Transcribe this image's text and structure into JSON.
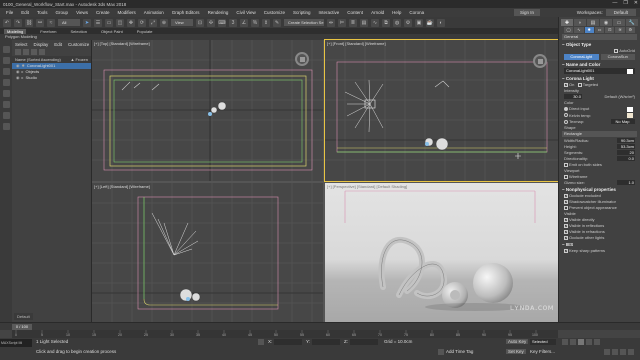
{
  "window": {
    "title": "0100_General_Workflow_Start.max - Autodesk 3ds Max 2018",
    "controls": [
      "—",
      "❐",
      "✕"
    ]
  },
  "menu": {
    "items": [
      "File",
      "Edit",
      "Tools",
      "Group",
      "Views",
      "Create",
      "Modifiers",
      "Animation",
      "Graph Editors",
      "Rendering",
      "Civil View",
      "Customize",
      "Scripting",
      "Interactive",
      "Content",
      "Arnold",
      "Help",
      "Corona"
    ],
    "sign_in": "Sign In",
    "workspaces_label": "Workspaces:",
    "workspace_value": "Default"
  },
  "toolbar": {
    "selection_filter": "All",
    "view": "View",
    "create_selection_set": "Create Selection Se"
  },
  "ribbon": {
    "tabs": [
      "Modeling",
      "Freeform",
      "Selection",
      "Object Paint",
      "Populate"
    ],
    "active_tab": "Modeling",
    "sub_label": "Polygon Modeling"
  },
  "scene_explorer": {
    "tabs": [
      "Select",
      "Display",
      "Edit",
      "Customize"
    ],
    "header": "Name (Sorted Ascending)",
    "header_right": "▲ Frozen",
    "rows": [
      {
        "name": "CoronaLight001",
        "selected": true
      },
      {
        "name": "Objects",
        "selected": false
      },
      {
        "name": "Studio",
        "selected": false
      }
    ],
    "footer": "Default"
  },
  "viewports": [
    {
      "key": "top",
      "label": "[+] [Top] [Standard] [Wireframe]"
    },
    {
      "key": "front",
      "label": "[+] [Front] [Standard] [Wireframe]"
    },
    {
      "key": "left",
      "label": "[+] [Left] [Standard] [Wireframe]"
    },
    {
      "key": "persp",
      "label": "[+] [Perspective] [Standard] [Default Shading]"
    }
  ],
  "command_panel": {
    "tabs": [
      "✚",
      "◗",
      "▤",
      "◉",
      "▭",
      "🔧"
    ],
    "category": "General",
    "object_type": {
      "title": "Object Type",
      "autogrid": "AutoGrid",
      "buttons": [
        "CoronaLight",
        "CoronaSun"
      ]
    },
    "name_and_color": {
      "title": "Name and Color",
      "name": "CoronaLight001"
    },
    "corona_light": {
      "title": "Corona Light",
      "on_label": "On",
      "targeted_label": "Targeted",
      "intensity_label": "Intensity",
      "intensity_value": "30.0",
      "intensity_unit": "Default (W/sr/m²)",
      "color_label": "Color",
      "direct_input": "Direct input",
      "kelvin_temp": "Kelvin temp:",
      "texmap": "Texmap:",
      "texmap_value": "No Map",
      "shape_label": "Shape",
      "shape_value": "Rectangle",
      "width_label": "Width/Radius:",
      "width_value": "90.3cm",
      "height_label": "Height:",
      "height_value": "53.3cm",
      "segments_label": "Segments:",
      "segments_value": "20",
      "directionality_label": "Directionality:",
      "directionality_value": "0.0",
      "emit_both": "Emit on both sides"
    },
    "viewport_section": {
      "title": "Viewport",
      "wireframe": "Wireframe",
      "gizmo_size": "Gizmo size:",
      "gizmo_value": "1.0"
    },
    "nonphysical": {
      "title": "Nonphysical properties",
      "items": [
        "Occlude excluded",
        "Shadowcatcher illuminator",
        "Prevent object appearance"
      ],
      "visible_label": "Visible",
      "visible_items": [
        "Visible directly",
        "Visible in reflections",
        "Visible in refractions",
        "Occlude other lights"
      ]
    },
    "ies": {
      "title": "IES",
      "items": [
        "Keep sharp patterns"
      ]
    }
  },
  "timeline": {
    "scrubber": "0 / 100",
    "ticks": [
      "0",
      "5",
      "10",
      "15",
      "20",
      "25",
      "30",
      "35",
      "40",
      "45",
      "50",
      "55",
      "60",
      "65",
      "70",
      "75",
      "80",
      "85",
      "90",
      "95",
      "100"
    ]
  },
  "status": {
    "maxscript": "MAXScript Mi",
    "line1": "1 Light Selected",
    "line2": "Click and drag to begin creation process",
    "x_label": "X:",
    "y_label": "Y:",
    "z_label": "Z:",
    "grid": "Grid = 10.0cm",
    "add_time_tag": "Add Time Tag",
    "auto_key": "Auto Key",
    "set_key": "Set Key",
    "selected": "Selected",
    "key_filters": "Key Filters..."
  },
  "watermark": "ʟʏɴᴅᴀ.ᴄᴏᴍ",
  "colors": {
    "active_border": "#e8c443",
    "selection": "#3c6fa8",
    "accent_button": "#4d84c7",
    "grid_line": "#5e5e5e",
    "green_frame": "#7fd36b",
    "pink_frame": "#d98fb1",
    "yellow_frame": "#d9d36b"
  }
}
